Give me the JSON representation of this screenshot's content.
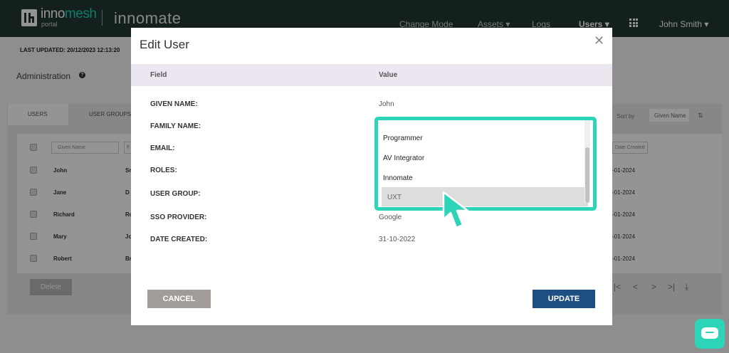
{
  "header": {
    "brand_prefix": "inno",
    "brand_suffix": "mesh",
    "brand_sub": "portal",
    "product": "innomate",
    "nav": [
      {
        "label": "Change Mode"
      },
      {
        "label": "Assets ▾"
      },
      {
        "label": "Logs"
      },
      {
        "label": "Users ▾"
      }
    ],
    "user": "John Smith ▾"
  },
  "page": {
    "last_updated": "LAST UPDATED: 20/12/2023 12:13:20",
    "title": "Administration",
    "help_glyph": "?",
    "tabs": [
      "USERS",
      "USER GROUPS"
    ],
    "sort_label": "Sort by",
    "sort_value": "Given Name",
    "sort_icon": "⇅",
    "filter_given": "Given Name",
    "filter_family": "F",
    "filter_date": "Date Created",
    "rows": [
      {
        "name": "John",
        "sfx": "Sr",
        "date": "-01-2024"
      },
      {
        "name": "Jane",
        "sfx": "D",
        "date": "-01-2024"
      },
      {
        "name": "Richard",
        "sfx": "Ro",
        "date": "-01-2024"
      },
      {
        "name": "Mary",
        "sfx": "Jo",
        "date": "-01-2024"
      },
      {
        "name": "Robert",
        "sfx": "Br",
        "date": "-01-2024"
      }
    ],
    "delete_label": "Delete",
    "pager": [
      "|<",
      "<",
      ">",
      ">|",
      "⤓"
    ]
  },
  "modal": {
    "title": "Edit User",
    "close_glyph": "✕",
    "col_field": "Field",
    "col_value": "Value",
    "fields": [
      {
        "label": "GIVEN NAME:",
        "value": "John"
      },
      {
        "label": "FAMILY NAME:",
        "value": ""
      },
      {
        "label": "EMAIL:",
        "value": ""
      },
      {
        "label": "ROLES:",
        "value": ""
      },
      {
        "label": "USER GROUP:",
        "value": ""
      },
      {
        "label": "SSO PROVIDER:",
        "value": "Google"
      },
      {
        "label": "DATE CREATED:",
        "value": "31-10-2022"
      }
    ],
    "dropdown_options": [
      "Programmer",
      "AV Integrator",
      "Innomate",
      "UXT"
    ],
    "dropdown_selected": "UXT",
    "cancel_label": "CANCEL",
    "update_label": "UPDATE"
  },
  "colors": {
    "header_bg": "#243733",
    "accent": "#2cd4b8",
    "update_button": "#1e4f82",
    "cancel_button": "#a19c99"
  }
}
